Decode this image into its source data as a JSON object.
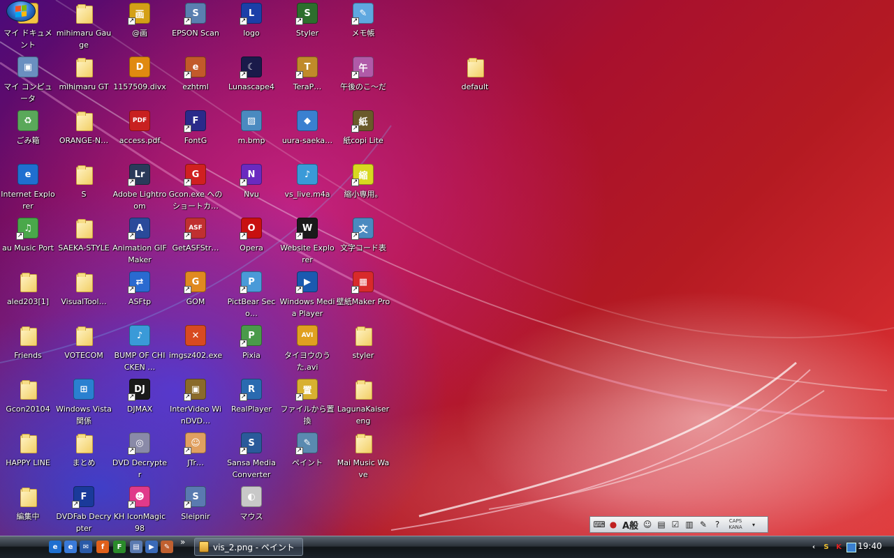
{
  "desktop": {
    "icons": [
      {
        "id": "my-documents",
        "label": "マイ ドキュメント",
        "kind": "app",
        "color": "#f5c542",
        "glyph": "📁",
        "shortcut": false
      },
      {
        "id": "mihimaru-gauge",
        "label": "mihimaru Gauge",
        "kind": "folder"
      },
      {
        "id": "at-ga",
        "label": "@画",
        "kind": "app",
        "color": "#d4a017",
        "glyph": "画",
        "shortcut": true
      },
      {
        "id": "epson-scan",
        "label": "EPSON Scan",
        "kind": "app",
        "color": "#5a7fb0",
        "glyph": "S",
        "shortcut": true
      },
      {
        "id": "logo",
        "label": "logo",
        "kind": "app",
        "color": "#1b3fa8",
        "glyph": "L",
        "shortcut": true
      },
      {
        "id": "styler",
        "label": "Styler",
        "kind": "app",
        "color": "#2d6e2d",
        "glyph": "S",
        "shortcut": true
      },
      {
        "id": "memo",
        "label": "メモ帳",
        "kind": "app",
        "color": "#5fa8e0",
        "glyph": "✎",
        "shortcut": true
      },
      {
        "id": "my-computer",
        "label": "マイ コンピュータ",
        "kind": "app",
        "color": "#6a8fc0",
        "glyph": "▣",
        "shortcut": false
      },
      {
        "id": "mihimaru-gt",
        "label": "mihimaru GT",
        "kind": "folder"
      },
      {
        "id": "divx",
        "label": "1157509.divx",
        "kind": "app",
        "color": "#e08a10",
        "glyph": "D",
        "shortcut": false
      },
      {
        "id": "ezhtml",
        "label": "ezhtml",
        "kind": "app",
        "color": "#c25a2a",
        "glyph": "e",
        "shortcut": true
      },
      {
        "id": "lunascape",
        "label": "Lunascape4",
        "kind": "app",
        "color": "#1a1a4a",
        "glyph": "☾",
        "shortcut": true
      },
      {
        "id": "terapad",
        "label": "TeraP…",
        "kind": "app",
        "color": "#c08a2a",
        "glyph": "T",
        "shortcut": true
      },
      {
        "id": "gogo-no-ko",
        "label": "午後のこ～だ",
        "kind": "app",
        "color": "#b05aa8",
        "glyph": "午",
        "shortcut": true
      },
      {
        "id": "recycle-bin",
        "label": "ごみ箱",
        "kind": "app",
        "color": "#5aa85a",
        "glyph": "♻",
        "shortcut": false
      },
      {
        "id": "orange-n",
        "label": "ORANGE-N…",
        "kind": "folder"
      },
      {
        "id": "access-pdf",
        "label": "access.pdf",
        "kind": "app",
        "color": "#c82020",
        "glyph": "PDF",
        "shortcut": false
      },
      {
        "id": "fontg",
        "label": "FontG",
        "kind": "app",
        "color": "#2a2a8a",
        "glyph": "F",
        "shortcut": true
      },
      {
        "id": "m-bmp",
        "label": "m.bmp",
        "kind": "app",
        "color": "#4a8ac0",
        "glyph": "▨",
        "shortcut": false
      },
      {
        "id": "uura-saeka",
        "label": "uura-saeka…",
        "kind": "app",
        "color": "#3a80d0",
        "glyph": "◆",
        "shortcut": false
      },
      {
        "id": "kami-copi",
        "label": "紙copi Lite",
        "kind": "app",
        "color": "#6a5a2a",
        "glyph": "紙",
        "shortcut": true
      },
      {
        "id": "internet-explorer",
        "label": "Internet Explorer",
        "kind": "app",
        "color": "#1f6fd0",
        "glyph": "e",
        "shortcut": false
      },
      {
        "id": "s-folder",
        "label": "S",
        "kind": "folder"
      },
      {
        "id": "adobe-lightroom",
        "label": "Adobe Lightroom",
        "kind": "app",
        "color": "#2a3a5a",
        "glyph": "Lr",
        "shortcut": true
      },
      {
        "id": "gcon-shortcut",
        "label": "Gcon.exe へのショートカ…",
        "kind": "app",
        "color": "#d02020",
        "glyph": "G",
        "shortcut": true
      },
      {
        "id": "nvu",
        "label": "Nvu",
        "kind": "app",
        "color": "#6a2ac0",
        "glyph": "N",
        "shortcut": true
      },
      {
        "id": "vs-live",
        "label": "vs_live.m4a",
        "kind": "app",
        "color": "#3a9ad8",
        "glyph": "♪",
        "shortcut": false
      },
      {
        "id": "shukusho",
        "label": "縮小専用。",
        "kind": "app",
        "color": "#d8d820",
        "glyph": "縮",
        "shortcut": true
      },
      {
        "id": "au-music-port",
        "label": "au Music Port",
        "kind": "app",
        "color": "#4aa84a",
        "glyph": "♫",
        "shortcut": true
      },
      {
        "id": "saeka-style",
        "label": "SAEKA-STYLE",
        "kind": "folder"
      },
      {
        "id": "animation-gif-maker",
        "label": "Animation GIF Maker",
        "kind": "app",
        "color": "#2a4a9a",
        "glyph": "A",
        "shortcut": true
      },
      {
        "id": "getasfstr",
        "label": "GetASFStr…",
        "kind": "app",
        "color": "#c03030",
        "glyph": "ASF",
        "shortcut": true
      },
      {
        "id": "opera",
        "label": "Opera",
        "kind": "app",
        "color": "#c81010",
        "glyph": "O",
        "shortcut": true
      },
      {
        "id": "website-explorer",
        "label": "Website Explorer",
        "kind": "app",
        "color": "#1a1a1a",
        "glyph": "W",
        "shortcut": true
      },
      {
        "id": "mojicode",
        "label": "文字コード表",
        "kind": "app",
        "color": "#4a8ac0",
        "glyph": "文",
        "shortcut": true
      },
      {
        "id": "aled203",
        "label": "aled203[1]",
        "kind": "folder"
      },
      {
        "id": "visualtool",
        "label": "VisualTool…",
        "kind": "folder"
      },
      {
        "id": "asftp",
        "label": "ASFtp",
        "kind": "app",
        "color": "#2a6ad0",
        "glyph": "⇄",
        "shortcut": true
      },
      {
        "id": "gom",
        "label": "GOM",
        "kind": "app",
        "color": "#e08a20",
        "glyph": "G",
        "shortcut": true
      },
      {
        "id": "pictbear",
        "label": "PictBear Seco…",
        "kind": "app",
        "color": "#4a9ad8",
        "glyph": "P",
        "shortcut": true
      },
      {
        "id": "wmp",
        "label": "Windows Media Player",
        "kind": "app",
        "color": "#1a5ab0",
        "glyph": "▶",
        "shortcut": true
      },
      {
        "id": "kabegami-maker",
        "label": "壁紙Maker Pro",
        "kind": "app",
        "color": "#d82a2a",
        "glyph": "▦",
        "shortcut": true
      },
      {
        "id": "friends",
        "label": "Friends",
        "kind": "folder"
      },
      {
        "id": "votecom",
        "label": "VOTECOM",
        "kind": "folder"
      },
      {
        "id": "bump-of-chicken",
        "label": "BUMP OF CHICKEN …",
        "kind": "app",
        "color": "#3a9ad8",
        "glyph": "♪",
        "shortcut": false
      },
      {
        "id": "imgsz",
        "label": "imgsz402.exe",
        "kind": "app",
        "color": "#d84a20",
        "glyph": "✕",
        "shortcut": false
      },
      {
        "id": "pixia",
        "label": "Pixia",
        "kind": "app",
        "color": "#4a9a4a",
        "glyph": "P",
        "shortcut": true
      },
      {
        "id": "taiyou-no-uta",
        "label": "タイヨウのうた.avi",
        "kind": "app",
        "color": "#e0a020",
        "glyph": "AVI",
        "shortcut": false
      },
      {
        "id": "styler-folder",
        "label": "styler",
        "kind": "folder"
      },
      {
        "id": "gcon20104",
        "label": "Gcon20104",
        "kind": "folder"
      },
      {
        "id": "windows-vista",
        "label": "Windows Vista 関係",
        "kind": "app",
        "color": "#2a80d0",
        "glyph": "⊞",
        "shortcut": false
      },
      {
        "id": "djmax",
        "label": "DJMAX",
        "kind": "app",
        "color": "#1a1a1a",
        "glyph": "DJ",
        "shortcut": true
      },
      {
        "id": "intervideo",
        "label": "InterVideo WinDVD…",
        "kind": "app",
        "color": "#8a6a2a",
        "glyph": "▣",
        "shortcut": true
      },
      {
        "id": "realplayer",
        "label": "RealPlayer",
        "kind": "app",
        "color": "#2a6ab0",
        "glyph": "R",
        "shortcut": true
      },
      {
        "id": "file-okikae",
        "label": "ファイルから置換",
        "kind": "app",
        "color": "#d8b030",
        "glyph": "置",
        "shortcut": true
      },
      {
        "id": "lagunakaiser",
        "label": "LagunaKaiser eng",
        "kind": "folder"
      },
      {
        "id": "happy-line",
        "label": "HAPPY LINE",
        "kind": "folder"
      },
      {
        "id": "matome",
        "label": "まとめ",
        "kind": "folder"
      },
      {
        "id": "dvd-decrypter",
        "label": "DVD Decrypter",
        "kind": "app",
        "color": "#8a8aa8",
        "glyph": "◎",
        "shortcut": true
      },
      {
        "id": "jtrim",
        "label": "JTr…",
        "kind": "app",
        "color": "#e0a060",
        "glyph": "☺",
        "shortcut": true
      },
      {
        "id": "sansa",
        "label": "Sansa Media Converter",
        "kind": "app",
        "color": "#2a5a9a",
        "glyph": "S",
        "shortcut": true
      },
      {
        "id": "paint",
        "label": "ペイント",
        "kind": "app",
        "color": "#5a8ab0",
        "glyph": "✎",
        "shortcut": true
      },
      {
        "id": "mai-music-wave",
        "label": "Mai Music Wave",
        "kind": "folder"
      },
      {
        "id": "henshu-chu",
        "label": "編集中",
        "kind": "folder"
      },
      {
        "id": "dvdfab",
        "label": "DVDFab Decrypter",
        "kind": "app",
        "color": "#1a3a9a",
        "glyph": "F",
        "shortcut": true
      },
      {
        "id": "iconmagic",
        "label": "KH IconMagic98",
        "kind": "app",
        "color": "#e03a8a",
        "glyph": "☻",
        "shortcut": true
      },
      {
        "id": "sleipnir",
        "label": "Sleipnir",
        "kind": "app",
        "color": "#5a7ab0",
        "glyph": "S",
        "shortcut": true
      },
      {
        "id": "mouse",
        "label": "マウス",
        "kind": "app",
        "color": "#c8c8c8",
        "glyph": "◐",
        "shortcut": false
      },
      {
        "id": "default-folder",
        "label": "default",
        "kind": "folder"
      }
    ]
  },
  "langbar": {
    "mode_label": "A般",
    "caps": "CAPS",
    "kana": "KANA"
  },
  "taskbar": {
    "task_button_label": "vis_2.png - ペイント",
    "chevron": "»",
    "tray_expand": "‹",
    "clock": "19:40"
  }
}
